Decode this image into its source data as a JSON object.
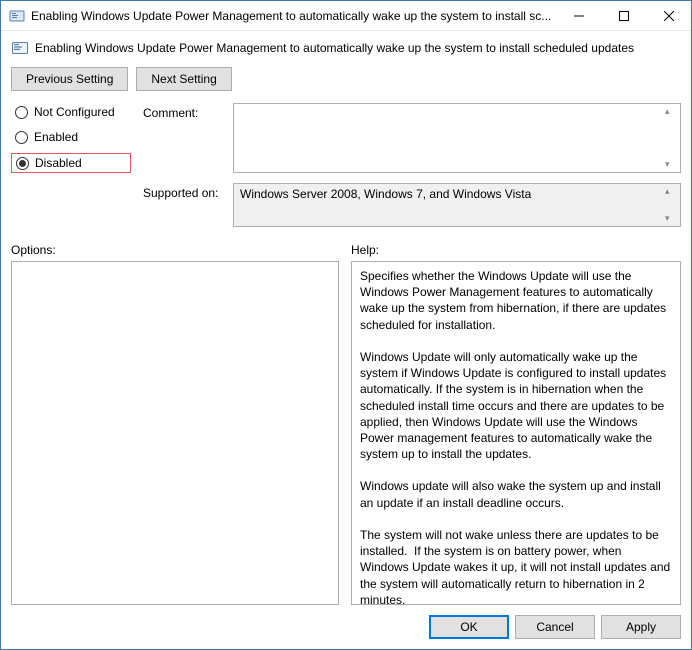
{
  "window": {
    "title": "Enabling Windows Update Power Management to automatically wake up the system to install sc..."
  },
  "policy": {
    "full_title": "Enabling Windows Update Power Management to automatically wake up the system to install scheduled updates"
  },
  "nav": {
    "prev": "Previous Setting",
    "next": "Next Setting"
  },
  "radios": {
    "not_configured": "Not Configured",
    "enabled": "Enabled",
    "disabled": "Disabled",
    "selected": "disabled"
  },
  "labels": {
    "comment": "Comment:",
    "supported": "Supported on:",
    "options": "Options:",
    "help": "Help:"
  },
  "supported_text": "Windows Server 2008, Windows 7, and Windows Vista",
  "comment_text": "",
  "options_text": "",
  "help_text": "Specifies whether the Windows Update will use the Windows Power Management features to automatically wake up the system from hibernation, if there are updates scheduled for installation.\n\nWindows Update will only automatically wake up the system if Windows Update is configured to install updates automatically. If the system is in hibernation when the scheduled install time occurs and there are updates to be applied, then Windows Update will use the Windows Power management features to automatically wake the system up to install the updates.\n\nWindows update will also wake the system up and install an update if an install deadline occurs.\n\nThe system will not wake unless there are updates to be installed.  If the system is on battery power, when Windows Update wakes it up, it will not install updates and the system will automatically return to hibernation in 2 minutes.",
  "footer": {
    "ok": "OK",
    "cancel": "Cancel",
    "apply": "Apply"
  }
}
